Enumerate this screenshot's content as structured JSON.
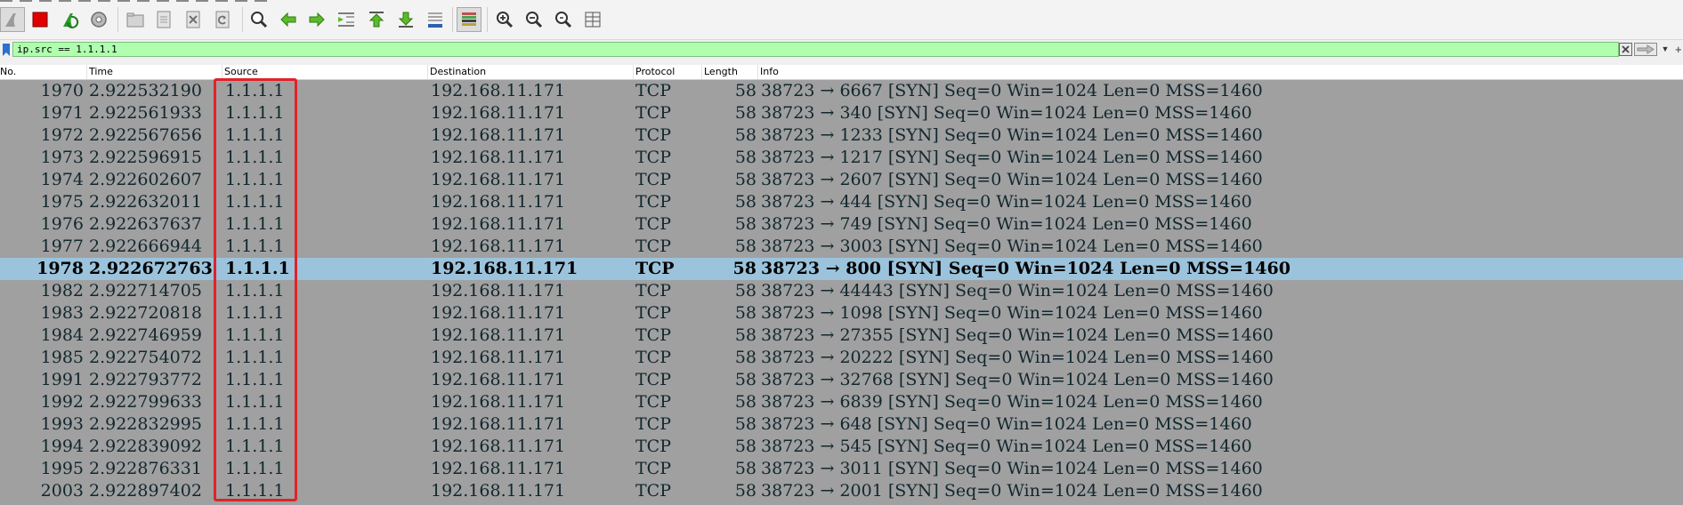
{
  "toolbar": {
    "buttons": [
      {
        "name": "shark-fin-start-icon"
      },
      {
        "name": "stop-capture-icon"
      },
      {
        "name": "restart-capture-icon"
      },
      {
        "name": "capture-options-icon"
      },
      {
        "name": "open-file-icon"
      },
      {
        "name": "save-file-icon"
      },
      {
        "name": "close-file-icon"
      },
      {
        "name": "reload-file-icon"
      },
      {
        "name": "find-packet-icon"
      },
      {
        "name": "go-back-icon"
      },
      {
        "name": "go-forward-icon"
      },
      {
        "name": "go-to-packet-icon"
      },
      {
        "name": "go-first-icon"
      },
      {
        "name": "go-last-icon"
      },
      {
        "name": "auto-scroll-icon"
      },
      {
        "name": "colorize-icon"
      },
      {
        "name": "zoom-in-icon"
      },
      {
        "name": "zoom-out-icon"
      },
      {
        "name": "normal-size-icon"
      },
      {
        "name": "resize-columns-icon"
      }
    ]
  },
  "filter": {
    "value": "ip.src == 1.1.1.1",
    "bg_color": "#afffaf"
  },
  "columns": {
    "no": "No.",
    "time": "Time",
    "source": "Source",
    "destination": "Destination",
    "protocol": "Protocol",
    "length": "Length",
    "info": "Info"
  },
  "packets": [
    {
      "no": "1970",
      "time": "2.922532190",
      "source": "1.1.1.1",
      "destination": "192.168.11.171",
      "protocol": "TCP",
      "length": "58",
      "info": "38723 → 6667 [SYN] Seq=0 Win=1024 Len=0 MSS=1460"
    },
    {
      "no": "1971",
      "time": "2.922561933",
      "source": "1.1.1.1",
      "destination": "192.168.11.171",
      "protocol": "TCP",
      "length": "58",
      "info": "38723 → 340 [SYN] Seq=0 Win=1024 Len=0 MSS=1460"
    },
    {
      "no": "1972",
      "time": "2.922567656",
      "source": "1.1.1.1",
      "destination": "192.168.11.171",
      "protocol": "TCP",
      "length": "58",
      "info": "38723 → 1233 [SYN] Seq=0 Win=1024 Len=0 MSS=1460"
    },
    {
      "no": "1973",
      "time": "2.922596915",
      "source": "1.1.1.1",
      "destination": "192.168.11.171",
      "protocol": "TCP",
      "length": "58",
      "info": "38723 → 1217 [SYN] Seq=0 Win=1024 Len=0 MSS=1460"
    },
    {
      "no": "1974",
      "time": "2.922602607",
      "source": "1.1.1.1",
      "destination": "192.168.11.171",
      "protocol": "TCP",
      "length": "58",
      "info": "38723 → 2607 [SYN] Seq=0 Win=1024 Len=0 MSS=1460"
    },
    {
      "no": "1975",
      "time": "2.922632011",
      "source": "1.1.1.1",
      "destination": "192.168.11.171",
      "protocol": "TCP",
      "length": "58",
      "info": "38723 → 444 [SYN] Seq=0 Win=1024 Len=0 MSS=1460"
    },
    {
      "no": "1976",
      "time": "2.922637637",
      "source": "1.1.1.1",
      "destination": "192.168.11.171",
      "protocol": "TCP",
      "length": "58",
      "info": "38723 → 749 [SYN] Seq=0 Win=1024 Len=0 MSS=1460"
    },
    {
      "no": "1977",
      "time": "2.922666944",
      "source": "1.1.1.1",
      "destination": "192.168.11.171",
      "protocol": "TCP",
      "length": "58",
      "info": "38723 → 3003 [SYN] Seq=0 Win=1024 Len=0 MSS=1460"
    },
    {
      "no": "1978",
      "time": "2.922672763",
      "source": "1.1.1.1",
      "destination": "192.168.11.171",
      "protocol": "TCP",
      "length": "58",
      "info": "38723 → 800 [SYN] Seq=0 Win=1024 Len=0 MSS=1460",
      "selected": true
    },
    {
      "no": "1982",
      "time": "2.922714705",
      "source": "1.1.1.1",
      "destination": "192.168.11.171",
      "protocol": "TCP",
      "length": "58",
      "info": "38723 → 44443 [SYN] Seq=0 Win=1024 Len=0 MSS=1460"
    },
    {
      "no": "1983",
      "time": "2.922720818",
      "source": "1.1.1.1",
      "destination": "192.168.11.171",
      "protocol": "TCP",
      "length": "58",
      "info": "38723 → 1098 [SYN] Seq=0 Win=1024 Len=0 MSS=1460"
    },
    {
      "no": "1984",
      "time": "2.922746959",
      "source": "1.1.1.1",
      "destination": "192.168.11.171",
      "protocol": "TCP",
      "length": "58",
      "info": "38723 → 27355 [SYN] Seq=0 Win=1024 Len=0 MSS=1460"
    },
    {
      "no": "1985",
      "time": "2.922754072",
      "source": "1.1.1.1",
      "destination": "192.168.11.171",
      "protocol": "TCP",
      "length": "58",
      "info": "38723 → 20222 [SYN] Seq=0 Win=1024 Len=0 MSS=1460"
    },
    {
      "no": "1991",
      "time": "2.922793772",
      "source": "1.1.1.1",
      "destination": "192.168.11.171",
      "protocol": "TCP",
      "length": "58",
      "info": "38723 → 32768 [SYN] Seq=0 Win=1024 Len=0 MSS=1460"
    },
    {
      "no": "1992",
      "time": "2.922799633",
      "source": "1.1.1.1",
      "destination": "192.168.11.171",
      "protocol": "TCP",
      "length": "58",
      "info": "38723 → 6839 [SYN] Seq=0 Win=1024 Len=0 MSS=1460"
    },
    {
      "no": "1993",
      "time": "2.922832995",
      "source": "1.1.1.1",
      "destination": "192.168.11.171",
      "protocol": "TCP",
      "length": "58",
      "info": "38723 → 648 [SYN] Seq=0 Win=1024 Len=0 MSS=1460"
    },
    {
      "no": "1994",
      "time": "2.922839092",
      "source": "1.1.1.1",
      "destination": "192.168.11.171",
      "protocol": "TCP",
      "length": "58",
      "info": "38723 → 545 [SYN] Seq=0 Win=1024 Len=0 MSS=1460"
    },
    {
      "no": "1995",
      "time": "2.922876331",
      "source": "1.1.1.1",
      "destination": "192.168.11.171",
      "protocol": "TCP",
      "length": "58",
      "info": "38723 → 3011 [SYN] Seq=0 Win=1024 Len=0 MSS=1460"
    },
    {
      "no": "2003",
      "time": "2.922897402",
      "source": "1.1.1.1",
      "destination": "192.168.11.171",
      "protocol": "TCP",
      "length": "58",
      "info": "38723 → 2001 [SYN] Seq=0 Win=1024 Len=0 MSS=1460"
    }
  ],
  "colors": {
    "row_bg": "#a0a0a0",
    "row_text": "#12272e",
    "selected_bg": "#9cc3dc",
    "annotation_box": "#e0222a"
  }
}
